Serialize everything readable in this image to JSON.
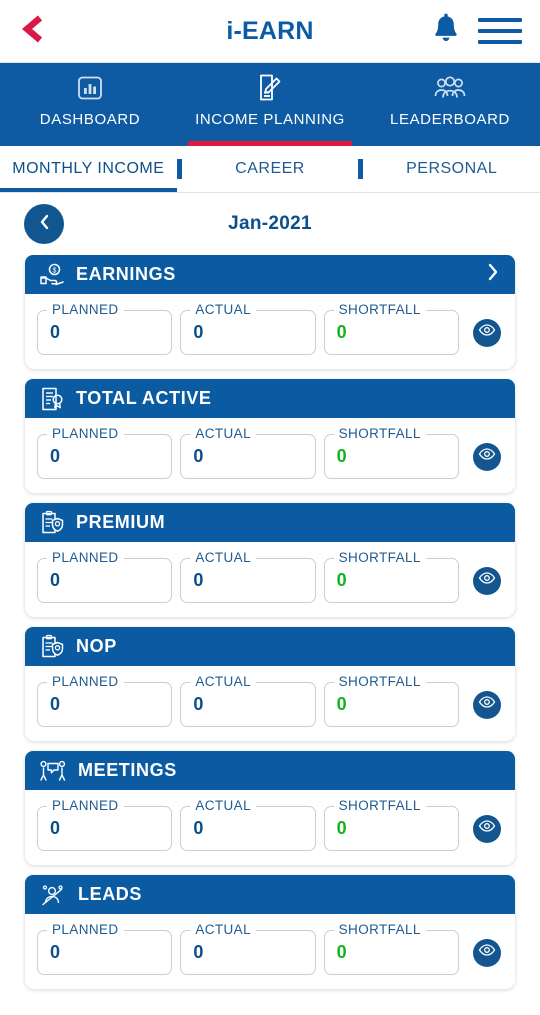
{
  "appbar": {
    "title": "i-EARN",
    "back_icon": "chevron-left-icon",
    "notification_icon": "bell-icon",
    "menu_icon": "hamburger-menu-icon",
    "back_color": "#d81b46",
    "title_color": "#0d5ba4"
  },
  "main_nav": {
    "accent_color": "#e01a3c",
    "background": "#0e5ba4",
    "tabs": [
      {
        "label": "DASHBOARD",
        "icon": "bar-chart-icon",
        "active": false
      },
      {
        "label": "INCOME PLANNING",
        "icon": "document-edit-icon",
        "active": true
      },
      {
        "label": "LEADERBOARD",
        "icon": "people-group-icon",
        "active": false
      }
    ]
  },
  "sub_tabs": {
    "items": [
      {
        "label": "MONTHLY INCOME",
        "active": true
      },
      {
        "label": "CAREER",
        "active": false
      },
      {
        "label": "PERSONAL",
        "active": false
      }
    ]
  },
  "date_bar": {
    "prev_icon": "chevron-left-icon",
    "period": "Jan-2021"
  },
  "field_labels": {
    "planned": "PLANNED",
    "actual": "ACTUAL",
    "shortfall": "SHORTFALL"
  },
  "eye_icon": "eye-icon",
  "chevron_icon": "chevron-right-icon",
  "colors": {
    "card_header": "#0b5ba3",
    "value_blue": "#0d4f88",
    "value_green": "#12b422",
    "eye_circle": "#13568f"
  },
  "cards": [
    {
      "title": "EARNINGS",
      "icon": "hand-coin-icon",
      "has_chevron": true,
      "planned": "0",
      "actual": "0",
      "shortfall": "0"
    },
    {
      "title": "TOTAL ACTIVE",
      "icon": "certificate-document-icon",
      "has_chevron": false,
      "planned": "0",
      "actual": "0",
      "shortfall": "0"
    },
    {
      "title": "PREMIUM",
      "icon": "clipboard-shield-icon",
      "has_chevron": false,
      "planned": "0",
      "actual": "0",
      "shortfall": "0"
    },
    {
      "title": "NOP",
      "icon": "clipboard-shield-icon",
      "has_chevron": false,
      "planned": "0",
      "actual": "0",
      "shortfall": "0"
    },
    {
      "title": "MEETINGS",
      "icon": "two-people-talking-icon",
      "has_chevron": false,
      "planned": "0",
      "actual": "0",
      "shortfall": "0"
    },
    {
      "title": "LEADS",
      "icon": "person-target-icon",
      "has_chevron": false,
      "planned": "0",
      "actual": "0",
      "shortfall": "0"
    }
  ]
}
